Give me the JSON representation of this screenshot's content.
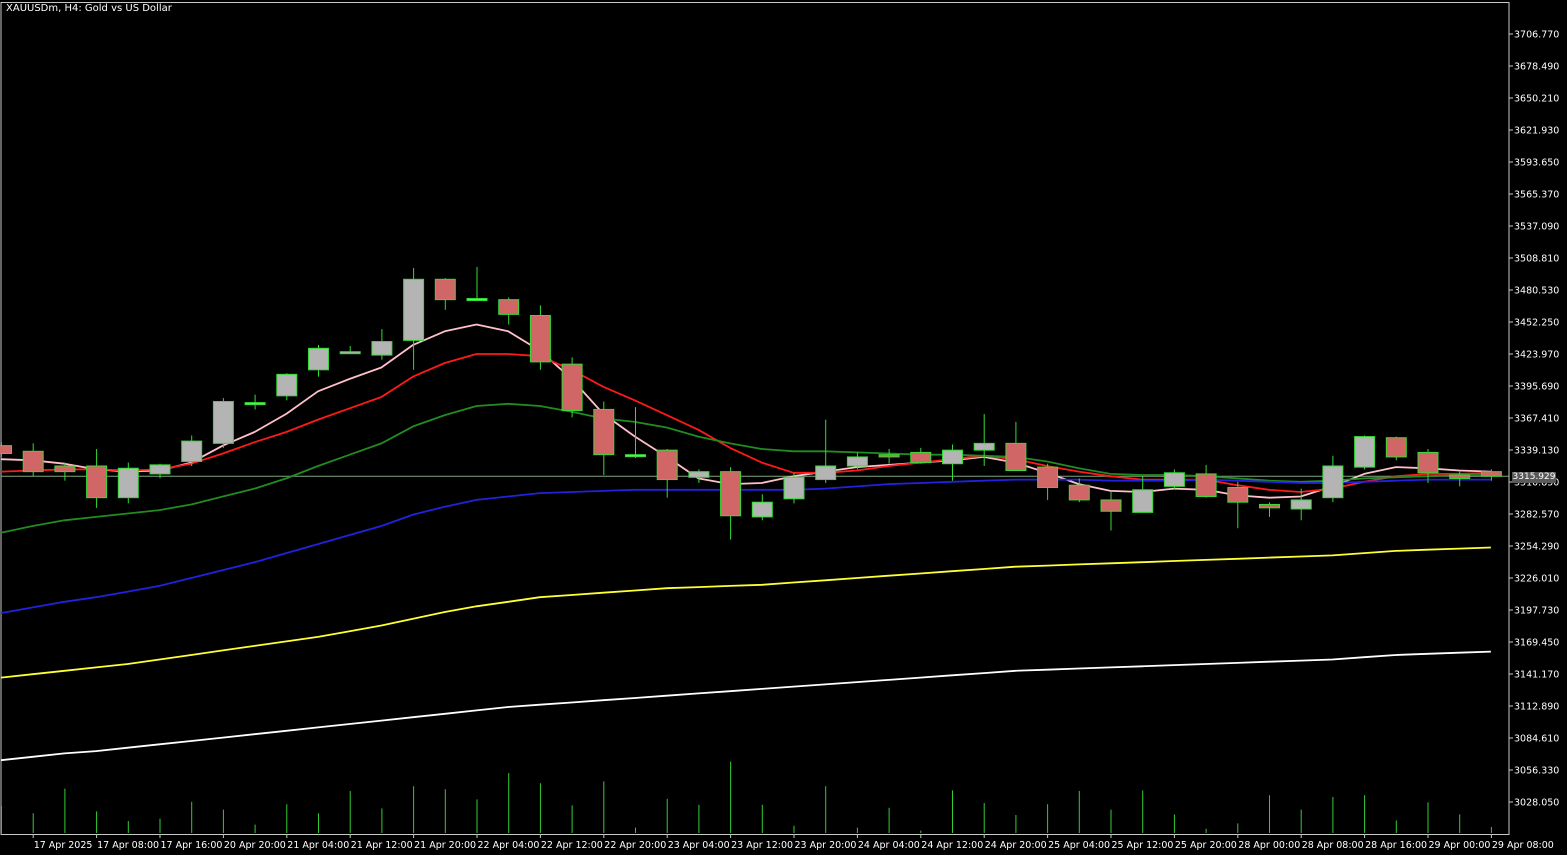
{
  "window": {
    "title": "XAUUSDm, H4:  Gold vs US Dollar",
    "current_price": "3315.929"
  },
  "colors": {
    "background": "#000000",
    "axis": "#c8c8c8",
    "bull": "#b4b4b4",
    "bear": "#d16666",
    "wick": "#33dd33",
    "volume": "#33cc33",
    "price_line": "#7fa67f"
  },
  "chart_data": {
    "type": "candlestick",
    "title": "XAUUSDm, H4:  Gold vs US Dollar",
    "timeframe": "H4",
    "ylim": [
      3006,
      3735
    ],
    "y_ticks": [
      "3706.770",
      "3678.490",
      "3650.210",
      "3621.930",
      "3593.650",
      "3565.370",
      "3537.090",
      "3508.810",
      "3480.530",
      "3452.250",
      "3423.970",
      "3395.690",
      "3367.410",
      "3339.130",
      "3310.850",
      "3282.570",
      "3254.290",
      "3226.010",
      "3197.730",
      "3169.450",
      "3141.170",
      "3112.890",
      "3084.610",
      "3056.330",
      "3028.050"
    ],
    "y_tick_values": [
      3706.77,
      3678.49,
      3650.21,
      3621.93,
      3593.65,
      3565.37,
      3537.09,
      3508.81,
      3480.53,
      3452.25,
      3423.97,
      3395.69,
      3367.41,
      3339.13,
      3310.85,
      3282.57,
      3254.29,
      3226.01,
      3197.73,
      3169.45,
      3141.17,
      3112.89,
      3084.61,
      3056.33,
      3028.05
    ],
    "x_labels": [
      "17 Apr 2025",
      "17 Apr 08:00",
      "17 Apr 16:00",
      "20 Apr 20:00",
      "21 Apr 04:00",
      "21 Apr 12:00",
      "21 Apr 20:00",
      "22 Apr 04:00",
      "22 Apr 12:00",
      "22 Apr 20:00",
      "23 Apr 04:00",
      "23 Apr 12:00",
      "23 Apr 20:00",
      "24 Apr 04:00",
      "24 Apr 12:00",
      "24 Apr 20:00",
      "25 Apr 04:00",
      "25 Apr 12:00",
      "25 Apr 20:00",
      "28 Apr 00:00",
      "28 Apr 08:00",
      "28 Apr 16:00",
      "29 Apr 00:00",
      "29 Apr 08:00"
    ],
    "x_label_candle_index": [
      1,
      3,
      5,
      7,
      9,
      11,
      13,
      15,
      17,
      19,
      21,
      23,
      25,
      27,
      29,
      31,
      33,
      35,
      37,
      39,
      41,
      43,
      45,
      47
    ],
    "current_price": 3315.93,
    "candles": [
      {
        "o": 3343,
        "h": 3346,
        "l": 3333,
        "c": 3336
      },
      {
        "o": 3338,
        "h": 3345,
        "l": 3316,
        "c": 3320
      },
      {
        "o": 3325,
        "h": 3328,
        "l": 3312,
        "c": 3320
      },
      {
        "o": 3325,
        "h": 3340,
        "l": 3288,
        "c": 3297
      },
      {
        "o": 3297,
        "h": 3328,
        "l": 3292,
        "c": 3323
      },
      {
        "o": 3318,
        "h": 3327,
        "l": 3314,
        "c": 3326
      },
      {
        "o": 3329,
        "h": 3352,
        "l": 3325,
        "c": 3347
      },
      {
        "o": 3345,
        "h": 3385,
        "l": 3341,
        "c": 3382
      },
      {
        "o": 3381,
        "h": 3388,
        "l": 3375,
        "c": 3381
      },
      {
        "o": 3387,
        "h": 3407,
        "l": 3383,
        "c": 3406
      },
      {
        "o": 3410,
        "h": 3432,
        "l": 3404,
        "c": 3429
      },
      {
        "o": 3426,
        "h": 3431,
        "l": 3425,
        "c": 3426
      },
      {
        "o": 3423,
        "h": 3446,
        "l": 3419,
        "c": 3435
      },
      {
        "o": 3436,
        "h": 3500,
        "l": 3410,
        "c": 3490
      },
      {
        "o": 3490,
        "h": 3491,
        "l": 3463,
        "c": 3472
      },
      {
        "o": 3472,
        "h": 3501,
        "l": 3472,
        "c": 3473
      },
      {
        "o": 3472,
        "h": 3474,
        "l": 3450,
        "c": 3459
      },
      {
        "o": 3458,
        "h": 3467,
        "l": 3410,
        "c": 3417
      },
      {
        "o": 3415,
        "h": 3421,
        "l": 3368,
        "c": 3374
      },
      {
        "o": 3375,
        "h": 3382,
        "l": 3317,
        "c": 3335
      },
      {
        "o": 3335,
        "h": 3377,
        "l": 3332,
        "c": 3335
      },
      {
        "o": 3339,
        "h": 3340,
        "l": 3297,
        "c": 3313
      },
      {
        "o": 3315,
        "h": 3322,
        "l": 3310,
        "c": 3320
      },
      {
        "o": 3320,
        "h": 3324,
        "l": 3260,
        "c": 3281
      },
      {
        "o": 3280,
        "h": 3300,
        "l": 3277,
        "c": 3293
      },
      {
        "o": 3296,
        "h": 3319,
        "l": 3292,
        "c": 3315
      },
      {
        "o": 3313,
        "h": 3366,
        "l": 3310,
        "c": 3325
      },
      {
        "o": 3325,
        "h": 3337,
        "l": 3322,
        "c": 3333
      },
      {
        "o": 3335,
        "h": 3340,
        "l": 3327,
        "c": 3333
      },
      {
        "o": 3337,
        "h": 3341,
        "l": 3327,
        "c": 3328
      },
      {
        "o": 3327,
        "h": 3344,
        "l": 3312,
        "c": 3339
      },
      {
        "o": 3339,
        "h": 3371,
        "l": 3325,
        "c": 3345
      },
      {
        "o": 3345,
        "h": 3364,
        "l": 3321,
        "c": 3321
      },
      {
        "o": 3324,
        "h": 3327,
        "l": 3295,
        "c": 3306
      },
      {
        "o": 3308,
        "h": 3314,
        "l": 3293,
        "c": 3295
      },
      {
        "o": 3295,
        "h": 3302,
        "l": 3268,
        "c": 3285
      },
      {
        "o": 3284,
        "h": 3316,
        "l": 3284,
        "c": 3304
      },
      {
        "o": 3307,
        "h": 3322,
        "l": 3304,
        "c": 3319
      },
      {
        "o": 3318,
        "h": 3326,
        "l": 3297,
        "c": 3298
      },
      {
        "o": 3306,
        "h": 3311,
        "l": 3270,
        "c": 3293
      },
      {
        "o": 3291,
        "h": 3293,
        "l": 3280,
        "c": 3288
      },
      {
        "o": 3287,
        "h": 3305,
        "l": 3277,
        "c": 3295
      },
      {
        "o": 3297,
        "h": 3334,
        "l": 3293,
        "c": 3325
      },
      {
        "o": 3324,
        "h": 3352,
        "l": 3322,
        "c": 3351
      },
      {
        "o": 3350,
        "h": 3351,
        "l": 3330,
        "c": 3333
      },
      {
        "o": 3337,
        "h": 3340,
        "l": 3310,
        "c": 3319
      },
      {
        "o": 3317,
        "h": 3320,
        "l": 3307,
        "c": 3314
      },
      {
        "o": 3320,
        "h": 3322,
        "l": 3312,
        "c": 3316
      }
    ],
    "volume_relative": [
      0.45,
      0.33,
      0.74,
      0.36,
      0.2,
      0.24,
      0.52,
      0.39,
      0.14,
      0.48,
      0.33,
      0.7,
      0.41,
      0.78,
      0.73,
      0.56,
      1.0,
      0.83,
      0.46,
      0.86,
      0.09,
      0.57,
      0.47,
      1.19,
      0.47,
      0.12,
      0.78,
      0.09,
      0.42,
      0.04,
      0.71,
      0.5,
      0.3,
      0.48,
      0.7,
      0.39,
      0.71,
      0.31,
      0.07,
      0.16,
      0.63,
      0.39,
      0.6,
      0.63,
      0.21,
      0.51,
      0.31,
      0.1
    ],
    "series": [
      {
        "color": "#ffc0cb",
        "values": [
          3331,
          3330,
          3327,
          3322,
          3320,
          3321,
          3328,
          3343,
          3355,
          3371,
          3391,
          3402,
          3412,
          3432,
          3444,
          3450,
          3444,
          3427,
          3402,
          3371,
          3351,
          3333,
          3314,
          3309,
          3310,
          3316,
          3320,
          3324,
          3326,
          3328,
          3330,
          3333,
          3328,
          3319,
          3309,
          3303,
          3302,
          3305,
          3304,
          3299,
          3297,
          3298,
          3307,
          3318,
          3324,
          3323,
          3321,
          3320
        ]
      },
      {
        "color": "#ff1a1a",
        "values": [
          3320,
          3321,
          3322,
          3322,
          3321,
          3322,
          3327,
          3336,
          3346,
          3355,
          3366,
          3376,
          3386,
          3404,
          3416,
          3424,
          3424,
          3422,
          3410,
          3395,
          3383,
          3370,
          3357,
          3341,
          3328,
          3319,
          3319,
          3321,
          3325,
          3328,
          3331,
          3334,
          3331,
          3325,
          3320,
          3316,
          3313,
          3313,
          3313,
          3308,
          3304,
          3302,
          3305,
          3311,
          3316,
          3318,
          3318,
          3319
        ]
      },
      {
        "color": "#228b22",
        "values": [
          3266,
          3272,
          3277,
          3280,
          3283,
          3286,
          3291,
          3298,
          3305,
          3314,
          3325,
          3335,
          3345,
          3360,
          3370,
          3378,
          3380,
          3378,
          3373,
          3367,
          3364,
          3359,
          3351,
          3345,
          3340,
          3338,
          3338,
          3337,
          3336,
          3335,
          3335,
          3334,
          3333,
          3329,
          3323,
          3318,
          3317,
          3317,
          3316,
          3314,
          3312,
          3311,
          3312,
          3314,
          3315,
          3316,
          3317,
          3317
        ]
      },
      {
        "color": "#2222dd",
        "values": [
          3195,
          3200,
          3205,
          3209,
          3214,
          3219,
          3226,
          3233,
          3240,
          3248,
          3256,
          3264,
          3272,
          3282,
          3289,
          3295,
          3298,
          3301,
          3302,
          3303,
          3304,
          3304,
          3304,
          3304,
          3304,
          3304,
          3305,
          3307,
          3309,
          3310,
          3311,
          3312,
          3313,
          3313,
          3313,
          3312,
          3312,
          3312,
          3313,
          3312,
          3311,
          3310,
          3310,
          3311,
          3312,
          3313,
          3313,
          3313
        ]
      },
      {
        "color": "#ffff33",
        "values": [
          3138,
          3141,
          3144,
          3147,
          3150,
          3154,
          3158,
          3162,
          3166,
          3170,
          3174,
          3179,
          3184,
          3190,
          3196,
          3201,
          3205,
          3209,
          3211,
          3213,
          3215,
          3217,
          3218,
          3219,
          3220,
          3222,
          3224,
          3226,
          3228,
          3230,
          3232,
          3234,
          3236,
          3237,
          3238,
          3239,
          3240,
          3241,
          3242,
          3243,
          3244,
          3245,
          3246,
          3248,
          3250,
          3251,
          3252,
          3253
        ]
      },
      {
        "color": "#ffffff",
        "values": [
          3065,
          3068,
          3071,
          3073,
          3076,
          3079,
          3082,
          3085,
          3088,
          3091,
          3094,
          3097,
          3100,
          3103,
          3106,
          3109,
          3112,
          3114,
          3116,
          3118,
          3120,
          3122,
          3124,
          3126,
          3128,
          3130,
          3132,
          3134,
          3136,
          3138,
          3140,
          3142,
          3144,
          3145,
          3146,
          3147,
          3148,
          3149,
          3150,
          3151,
          3152,
          3153,
          3154,
          3156,
          3158,
          3159,
          3160,
          3161
        ]
      }
    ]
  }
}
